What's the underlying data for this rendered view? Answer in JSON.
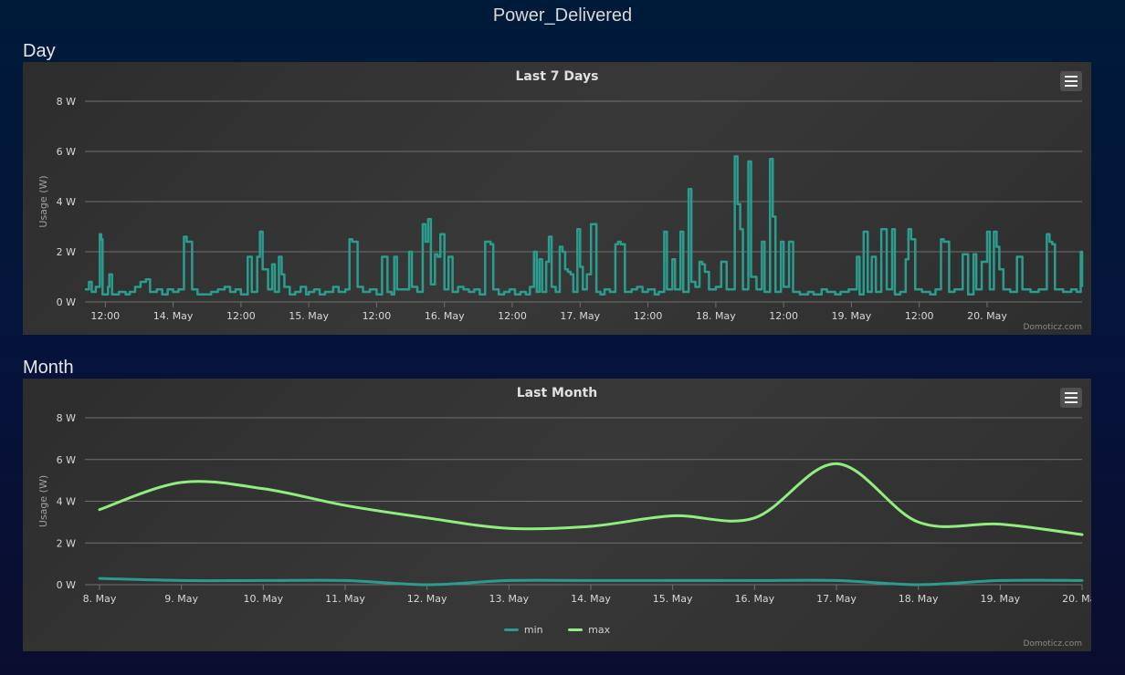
{
  "page": {
    "title": "Power_Delivered"
  },
  "sections": {
    "day": "Day",
    "month": "Month"
  },
  "credit": "Domoticz.com",
  "chart_data": [
    {
      "type": "line",
      "title": "Last 7 Days",
      "ylabel": "Usage (W)",
      "ylim": [
        0,
        8
      ],
      "yticks": [
        "0 W",
        "2 W",
        "4 W",
        "6 W",
        "8 W"
      ],
      "xticks": [
        "12:00",
        "14. May",
        "12:00",
        "15. May",
        "12:00",
        "16. May",
        "12:00",
        "17. May",
        "12:00",
        "18. May",
        "12:00",
        "19. May",
        "12:00",
        "20. May"
      ],
      "x_range_days": [
        13.35,
        20.7
      ],
      "color": "#2a9d8f",
      "series": [
        {
          "values": [
            [
              13.35,
              0.5
            ],
            [
              13.38,
              0.8
            ],
            [
              13.4,
              0.4
            ],
            [
              13.43,
              0.6
            ],
            [
              13.46,
              2.7
            ],
            [
              13.47,
              2.5
            ],
            [
              13.48,
              0.3
            ],
            [
              13.52,
              0.6
            ],
            [
              13.53,
              1.1
            ],
            [
              13.55,
              0.3
            ],
            [
              13.6,
              0.4
            ],
            [
              13.65,
              0.3
            ],
            [
              13.68,
              0.4
            ],
            [
              13.72,
              0.6
            ],
            [
              13.76,
              0.8
            ],
            [
              13.8,
              0.9
            ],
            [
              13.83,
              0.4
            ],
            [
              13.88,
              0.5
            ],
            [
              13.92,
              0.3
            ],
            [
              13.96,
              0.5
            ],
            [
              14.0,
              0.4
            ],
            [
              14.04,
              0.5
            ],
            [
              14.08,
              2.6
            ],
            [
              14.1,
              2.4
            ],
            [
              14.12,
              2.4
            ],
            [
              14.14,
              0.5
            ],
            [
              14.18,
              0.3
            ],
            [
              14.22,
              0.3
            ],
            [
              14.28,
              0.4
            ],
            [
              14.33,
              0.5
            ],
            [
              14.38,
              0.6
            ],
            [
              14.42,
              0.4
            ],
            [
              14.46,
              0.5
            ],
            [
              14.5,
              0.3
            ],
            [
              14.55,
              1.8
            ],
            [
              14.58,
              0.4
            ],
            [
              14.62,
              1.8
            ],
            [
              14.64,
              2.8
            ],
            [
              14.66,
              1.3
            ],
            [
              14.68,
              1.3
            ],
            [
              14.7,
              0.5
            ],
            [
              14.73,
              1.5
            ],
            [
              14.75,
              0.4
            ],
            [
              14.78,
              1.8
            ],
            [
              14.8,
              1.1
            ],
            [
              14.82,
              0.6
            ],
            [
              14.86,
              0.3
            ],
            [
              14.9,
              0.4
            ],
            [
              14.94,
              0.6
            ],
            [
              14.98,
              0.3
            ],
            [
              15.0,
              0.4
            ],
            [
              15.04,
              0.5
            ],
            [
              15.08,
              0.3
            ],
            [
              15.12,
              0.4
            ],
            [
              15.18,
              0.6
            ],
            [
              15.22,
              0.4
            ],
            [
              15.27,
              0.5
            ],
            [
              15.3,
              2.5
            ],
            [
              15.32,
              2.4
            ],
            [
              15.34,
              2.4
            ],
            [
              15.36,
              0.6
            ],
            [
              15.4,
              0.4
            ],
            [
              15.45,
              0.5
            ],
            [
              15.5,
              0.3
            ],
            [
              15.54,
              1.8
            ],
            [
              15.56,
              1.8
            ],
            [
              15.58,
              0.4
            ],
            [
              15.61,
              0.3
            ],
            [
              15.63,
              1.8
            ],
            [
              15.65,
              0.5
            ],
            [
              15.7,
              0.5
            ],
            [
              15.74,
              2.0
            ],
            [
              15.76,
              0.6
            ],
            [
              15.8,
              0.4
            ],
            [
              15.84,
              3.1
            ],
            [
              15.86,
              2.4
            ],
            [
              15.88,
              3.3
            ],
            [
              15.9,
              0.7
            ],
            [
              15.93,
              1.9
            ],
            [
              15.95,
              1.8
            ],
            [
              15.97,
              2.7
            ],
            [
              16.0,
              0.5
            ],
            [
              16.03,
              1.8
            ],
            [
              16.06,
              0.4
            ],
            [
              16.1,
              0.6
            ],
            [
              16.14,
              0.5
            ],
            [
              16.18,
              0.4
            ],
            [
              16.22,
              0.5
            ],
            [
              16.26,
              0.3
            ],
            [
              16.3,
              2.4
            ],
            [
              16.32,
              2.4
            ],
            [
              16.34,
              2.3
            ],
            [
              16.36,
              0.5
            ],
            [
              16.4,
              0.3
            ],
            [
              16.44,
              0.4
            ],
            [
              16.48,
              0.5
            ],
            [
              16.52,
              0.3
            ],
            [
              16.56,
              0.4
            ],
            [
              16.6,
              0.3
            ],
            [
              16.63,
              0.6
            ],
            [
              16.66,
              2.0
            ],
            [
              16.68,
              0.4
            ],
            [
              16.7,
              1.7
            ],
            [
              16.72,
              0.4
            ],
            [
              16.75,
              1.6
            ],
            [
              16.77,
              2.6
            ],
            [
              16.79,
              0.6
            ],
            [
              16.82,
              0.4
            ],
            [
              16.85,
              2.2
            ],
            [
              16.87,
              2.0
            ],
            [
              16.89,
              1.3
            ],
            [
              16.91,
              1.2
            ],
            [
              16.93,
              1.1
            ],
            [
              16.95,
              0.4
            ],
            [
              16.98,
              2.9
            ],
            [
              17.0,
              1.4
            ],
            [
              17.02,
              0.5
            ],
            [
              17.05,
              1.1
            ],
            [
              17.08,
              3.1
            ],
            [
              17.1,
              3.1
            ],
            [
              17.12,
              0.4
            ],
            [
              17.15,
              0.3
            ],
            [
              17.18,
              0.5
            ],
            [
              17.22,
              0.4
            ],
            [
              17.26,
              2.3
            ],
            [
              17.28,
              2.4
            ],
            [
              17.3,
              2.3
            ],
            [
              17.33,
              0.4
            ],
            [
              17.38,
              0.5
            ],
            [
              17.42,
              0.6
            ],
            [
              17.46,
              0.4
            ],
            [
              17.5,
              0.5
            ],
            [
              17.55,
              0.3
            ],
            [
              17.58,
              0.4
            ],
            [
              17.62,
              2.8
            ],
            [
              17.64,
              0.5
            ],
            [
              17.68,
              1.7
            ],
            [
              17.7,
              0.5
            ],
            [
              17.74,
              2.8
            ],
            [
              17.76,
              0.4
            ],
            [
              17.8,
              4.5
            ],
            [
              17.82,
              0.8
            ],
            [
              17.85,
              0.6
            ],
            [
              17.88,
              1.6
            ],
            [
              17.9,
              1.5
            ],
            [
              17.92,
              1.2
            ],
            [
              17.95,
              0.5
            ],
            [
              18.0,
              0.6
            ],
            [
              18.04,
              1.6
            ],
            [
              18.06,
              1.6
            ],
            [
              18.08,
              0.5
            ],
            [
              18.14,
              5.8
            ],
            [
              18.16,
              3.9
            ],
            [
              18.18,
              2.9
            ],
            [
              18.2,
              0.5
            ],
            [
              18.24,
              5.6
            ],
            [
              18.26,
              1.0
            ],
            [
              18.3,
              0.5
            ],
            [
              18.34,
              2.4
            ],
            [
              18.36,
              0.4
            ],
            [
              18.4,
              5.7
            ],
            [
              18.42,
              3.4
            ],
            [
              18.44,
              0.4
            ],
            [
              18.48,
              2.4
            ],
            [
              18.5,
              0.6
            ],
            [
              18.54,
              2.4
            ],
            [
              18.57,
              0.4
            ],
            [
              18.62,
              0.3
            ],
            [
              18.68,
              0.4
            ],
            [
              18.72,
              0.3
            ],
            [
              18.78,
              0.5
            ],
            [
              18.82,
              0.4
            ],
            [
              18.88,
              0.3
            ],
            [
              18.92,
              0.4
            ],
            [
              18.98,
              0.5
            ],
            [
              19.04,
              1.8
            ],
            [
              19.06,
              0.3
            ],
            [
              19.09,
              2.8
            ],
            [
              19.12,
              0.4
            ],
            [
              19.15,
              1.8
            ],
            [
              19.18,
              0.4
            ],
            [
              19.22,
              2.9
            ],
            [
              19.26,
              0.5
            ],
            [
              19.3,
              2.9
            ],
            [
              19.32,
              0.3
            ],
            [
              19.36,
              0.4
            ],
            [
              19.4,
              1.7
            ],
            [
              19.42,
              2.9
            ],
            [
              19.44,
              2.5
            ],
            [
              19.47,
              0.5
            ],
            [
              19.52,
              0.4
            ],
            [
              19.58,
              0.3
            ],
            [
              19.62,
              0.5
            ],
            [
              19.66,
              2.5
            ],
            [
              19.68,
              2.4
            ],
            [
              19.7,
              2.4
            ],
            [
              19.72,
              0.4
            ],
            [
              19.76,
              0.5
            ],
            [
              19.82,
              1.9
            ],
            [
              19.86,
              0.3
            ],
            [
              19.9,
              1.9
            ],
            [
              19.92,
              0.5
            ],
            [
              19.96,
              1.6
            ],
            [
              20.0,
              2.8
            ],
            [
              20.02,
              0.5
            ],
            [
              20.05,
              2.8
            ],
            [
              20.07,
              2.2
            ],
            [
              20.09,
              1.3
            ],
            [
              20.12,
              0.5
            ],
            [
              20.17,
              0.4
            ],
            [
              20.22,
              1.8
            ],
            [
              20.26,
              0.5
            ],
            [
              20.32,
              0.4
            ],
            [
              20.38,
              0.5
            ],
            [
              20.44,
              2.7
            ],
            [
              20.46,
              2.4
            ],
            [
              20.48,
              2.3
            ],
            [
              20.5,
              0.5
            ],
            [
              20.56,
              0.4
            ],
            [
              20.62,
              0.5
            ],
            [
              20.66,
              0.4
            ],
            [
              20.69,
              2.0
            ],
            [
              20.7,
              0.6
            ]
          ]
        }
      ]
    },
    {
      "type": "line",
      "title": "Last Month",
      "ylabel": "Usage (W)",
      "ylim": [
        0,
        8
      ],
      "yticks": [
        "0 W",
        "2 W",
        "4 W",
        "6 W",
        "8 W"
      ],
      "categories": [
        "8. May",
        "9. May",
        "10. May",
        "11. May",
        "12. May",
        "13. May",
        "14. May",
        "15. May",
        "16. May",
        "17. May",
        "18. May",
        "19. May",
        "20. May"
      ],
      "legend": "bottom-center",
      "series": [
        {
          "name": "min",
          "color": "#2a9d8f",
          "values": [
            0.3,
            0.2,
            0.2,
            0.2,
            0.0,
            0.2,
            0.2,
            0.2,
            0.2,
            0.2,
            0.0,
            0.2,
            0.2
          ]
        },
        {
          "name": "max",
          "color": "#90ee7e",
          "values": [
            3.6,
            4.9,
            4.6,
            3.8,
            3.2,
            2.7,
            2.8,
            3.3,
            3.2,
            5.8,
            3.0,
            2.9,
            2.4
          ]
        }
      ]
    }
  ]
}
